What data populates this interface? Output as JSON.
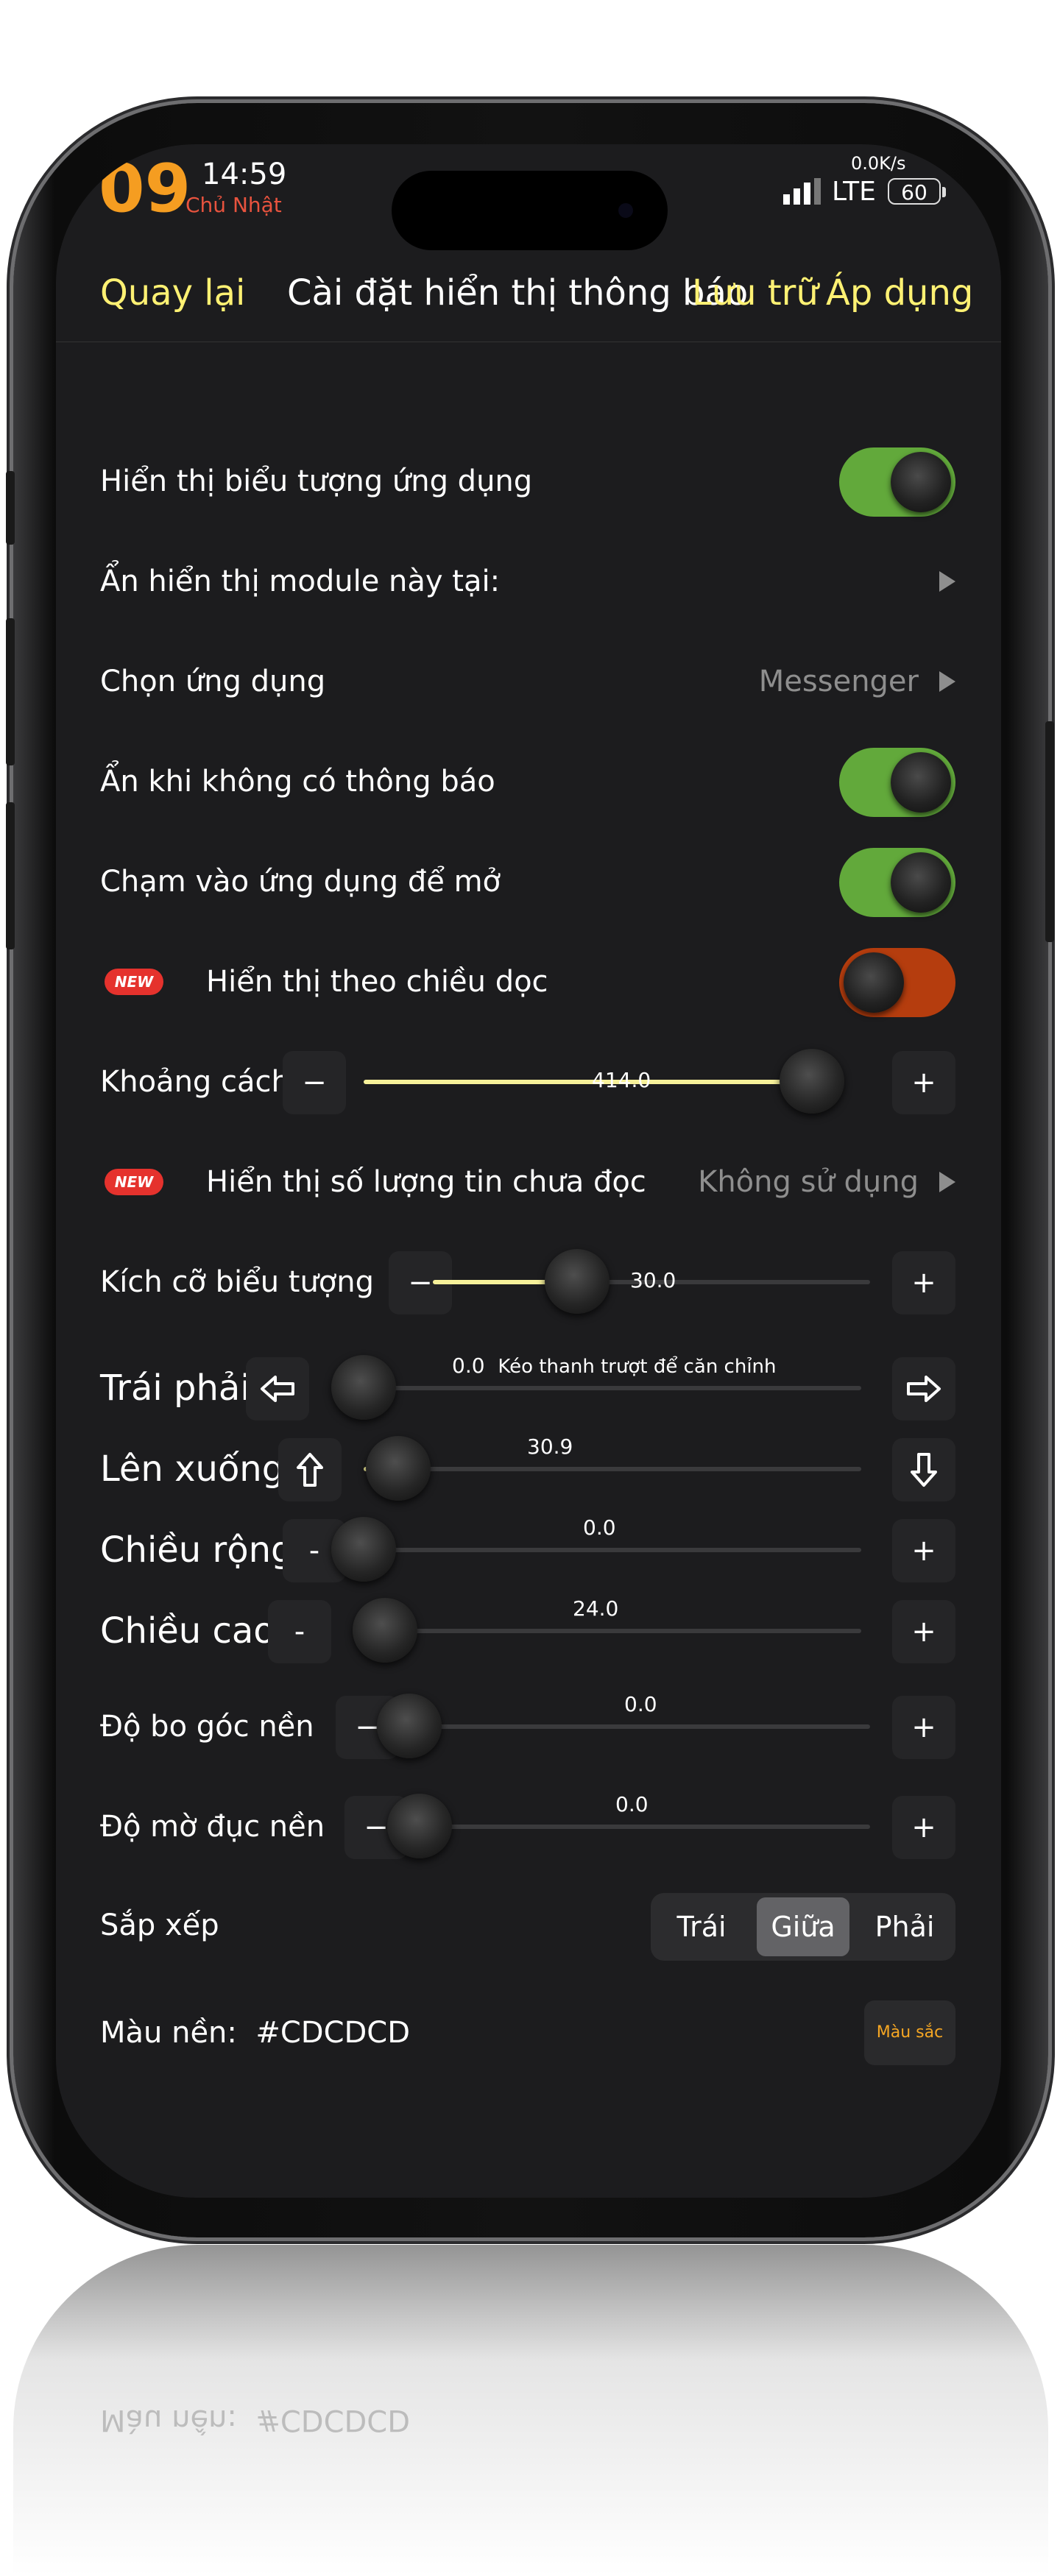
{
  "status_bar": {
    "big_time": "09",
    "time": "14:59",
    "day": "Chủ Nhật",
    "network_speed": "0.0K/s",
    "carrier": "LTE",
    "battery": "60"
  },
  "nav": {
    "back": "Quay lại",
    "title": "Cài đặt hiển thị thông báo",
    "save": "Lưu trữ",
    "apply": "Áp dụng"
  },
  "settings": {
    "show_app_icon": {
      "label": "Hiển thị biểu tượng ứng dụng",
      "on": true
    },
    "hide_module_at": {
      "label": "Ẩn hiển thị module này tại:"
    },
    "choose_app": {
      "label": "Chọn ứng dụng",
      "value": "Messenger"
    },
    "hide_when_no_notif": {
      "label": "Ẩn khi không có thông báo",
      "on": true
    },
    "tap_to_open": {
      "label": "Chạm vào ứng dụng để mở",
      "on": true
    },
    "vertical": {
      "badge": "NEW",
      "label": "Hiển thị theo chiều dọc",
      "on": false
    },
    "spacing": {
      "label": "Khoảng cách",
      "value": "414.0",
      "fraction": 0.94,
      "minus": "−",
      "plus": "+"
    },
    "unread_count": {
      "badge": "NEW",
      "label": "Hiển thị số lượng tin chưa đọc",
      "value": "Không sử dụng"
    },
    "icon_size": {
      "label": "Kích cỡ biểu tượng",
      "value": "30.0",
      "fraction": 0.33,
      "minus": "−",
      "plus": "+"
    },
    "left_right": {
      "label": "Trái phải",
      "value": "0.0",
      "hint": "Kéo thanh trượt để căn chỉnh",
      "fraction": 0.0
    },
    "up_down": {
      "label": "Lên xuống",
      "value": "30.9",
      "fraction": 0.07
    },
    "width": {
      "label": "Chiều rộng",
      "value": "0.0",
      "fraction": 0.0,
      "minus": "-",
      "plus": "+"
    },
    "height": {
      "label": "Chiều cao",
      "value": "24.0",
      "fraction": 0.06,
      "minus": "-",
      "plus": "+"
    },
    "corner_radius": {
      "label": "Độ bo góc nền",
      "value": "0.0",
      "fraction": 0.0,
      "minus": "−",
      "plus": "+"
    },
    "opacity": {
      "label": "Độ mờ đục nền",
      "value": "0.0",
      "fraction": 0.0,
      "minus": "−",
      "plus": "+"
    },
    "arrange": {
      "label": "Sắp xếp",
      "options": [
        "Trái",
        "Giữa",
        "Phải"
      ],
      "selected": "Giữa"
    },
    "bg_color": {
      "label": "Màu nền:",
      "value": "#CDCDCD",
      "button": "Màu sắc"
    }
  },
  "icons": {
    "left_arrow": "arrow-left-icon",
    "right_arrow": "arrow-right-icon",
    "up_arrow": "arrow-up-icon",
    "down_arrow": "arrow-down-icon",
    "chevron": "chevron-right-icon"
  },
  "colors": {
    "accent_yellow": "#fff173",
    "toggle_on": "#62a93b",
    "toggle_orange": "#b53d0e",
    "badge_red": "#e5322d",
    "slider_fill": "#f7f19a"
  }
}
